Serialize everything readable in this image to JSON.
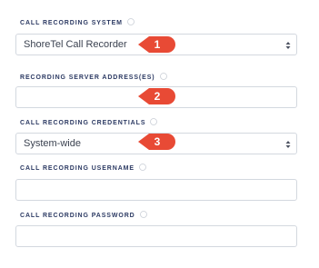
{
  "fields": [
    {
      "label": "CALL RECORDING SYSTEM",
      "value": "ShoreTel Call Recorder",
      "type": "select"
    },
    {
      "label": "RECORDING SERVER ADDRESS(ES)",
      "value": "",
      "type": "text"
    },
    {
      "label": "CALL RECORDING CREDENTIALS",
      "value": "System-wide",
      "type": "select"
    },
    {
      "label": "CALL RECORDING USERNAME",
      "value": "",
      "type": "text"
    },
    {
      "label": "CALL RECORDING PASSWORD",
      "value": "",
      "type": "text"
    }
  ],
  "markers": [
    "1",
    "2",
    "3"
  ],
  "colors": {
    "label": "#2c3a63",
    "marker": "#e84a35",
    "border": "#d3d8df",
    "icon": "#c9ced6"
  },
  "icons": {
    "info": "info-circle-icon",
    "select": "up-down-caret-icon"
  }
}
